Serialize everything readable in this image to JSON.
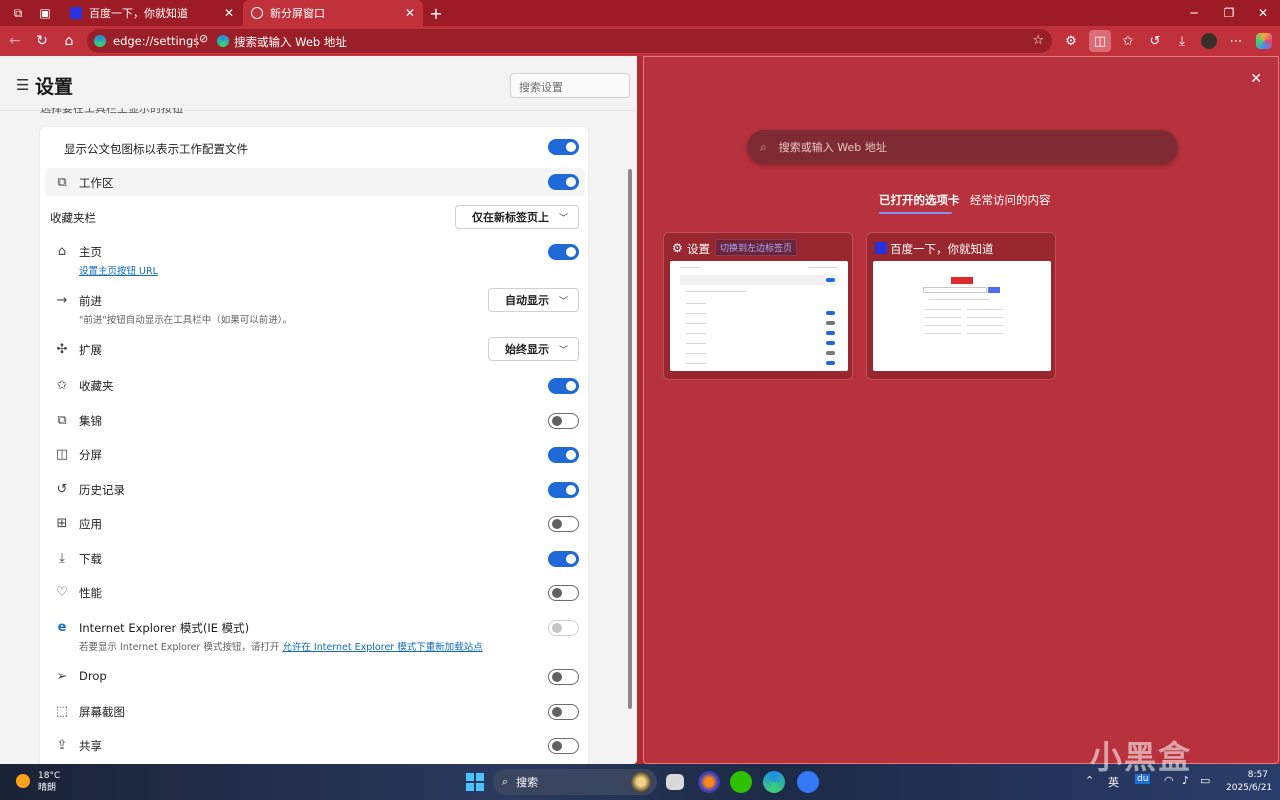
{
  "browser": {
    "tabs": [
      {
        "label": "百度一下，你就知道",
        "active": false
      },
      {
        "label": "新分屏窗口",
        "active": true
      }
    ],
    "address": {
      "url": "edge://settings",
      "second_url": "搜索或输入 Web 地址"
    }
  },
  "settings": {
    "title": "设置",
    "search_placeholder": "搜索设置",
    "partial_header": "选择要在工具栏上显示的按钮",
    "rows": [
      {
        "label": "显示公文包图标以表示工作配置文件",
        "control": "toggle",
        "state": "on"
      },
      {
        "label": "工作区",
        "control": "toggle",
        "state": "on",
        "icon": "workspaces-icon"
      },
      {
        "label": "收藏夹栏",
        "control": "dropdown",
        "value": "仅在新标签页上"
      },
      {
        "label": "主页",
        "sub_link": "设置主页按钮 URL",
        "control": "toggle",
        "state": "on",
        "icon": "home-icon"
      },
      {
        "label": "前进",
        "sub": "\"前进\"按钮自动显示在工具栏中（如果可以前进）。",
        "control": "dropdown",
        "value": "自动显示",
        "icon": "forward-arrow-icon"
      },
      {
        "label": "扩展",
        "control": "dropdown",
        "value": "始终显示",
        "icon": "extensions-icon"
      },
      {
        "label": "收藏夹",
        "control": "toggle",
        "state": "on",
        "icon": "favorites-icon"
      },
      {
        "label": "集锦",
        "control": "toggle",
        "state": "off",
        "icon": "collections-icon"
      },
      {
        "label": "分屏",
        "control": "toggle",
        "state": "on",
        "icon": "split-screen-icon"
      },
      {
        "label": "历史记录",
        "control": "toggle",
        "state": "on",
        "icon": "history-icon"
      },
      {
        "label": "应用",
        "control": "toggle",
        "state": "off",
        "icon": "apps-icon"
      },
      {
        "label": "下载",
        "control": "toggle",
        "state": "on",
        "icon": "download-icon"
      },
      {
        "label": "性能",
        "control": "toggle",
        "state": "off",
        "icon": "performance-icon"
      },
      {
        "label": "Internet Explorer 模式(IE 模式)",
        "sub": "若要显示 Internet Explorer 模式按钮，请打开",
        "sub_link": "允许在 Internet Explorer 模式下重新加载站点",
        "control": "toggle",
        "state": "disabled",
        "icon": "ie-icon"
      },
      {
        "label": "Drop",
        "control": "toggle",
        "state": "off",
        "icon": "drop-icon"
      },
      {
        "label": "屏幕截图",
        "control": "toggle",
        "state": "off",
        "icon": "screenshot-icon"
      },
      {
        "label": "共享",
        "control": "toggle",
        "state": "off",
        "icon": "share-icon"
      }
    ]
  },
  "split_pane": {
    "search_placeholder": "搜索或输入 Web 地址",
    "tabs": [
      "已打开的选项卡",
      "经常访问的内容"
    ],
    "active_tab": 0,
    "cards": [
      {
        "title": "设置",
        "badge": "切换到左边标签页"
      },
      {
        "title": "百度一下，你就知道"
      }
    ]
  },
  "taskbar": {
    "weather_temp": "18°C",
    "weather_desc": "晴朗",
    "search_label": "搜索",
    "ime": "英",
    "time": "8:57",
    "date": "2025/6/21"
  },
  "watermark": "小黑盒",
  "colors": {
    "accent": "#2069d9",
    "frame": "#c0313b",
    "split_bg": "#b7323c"
  }
}
